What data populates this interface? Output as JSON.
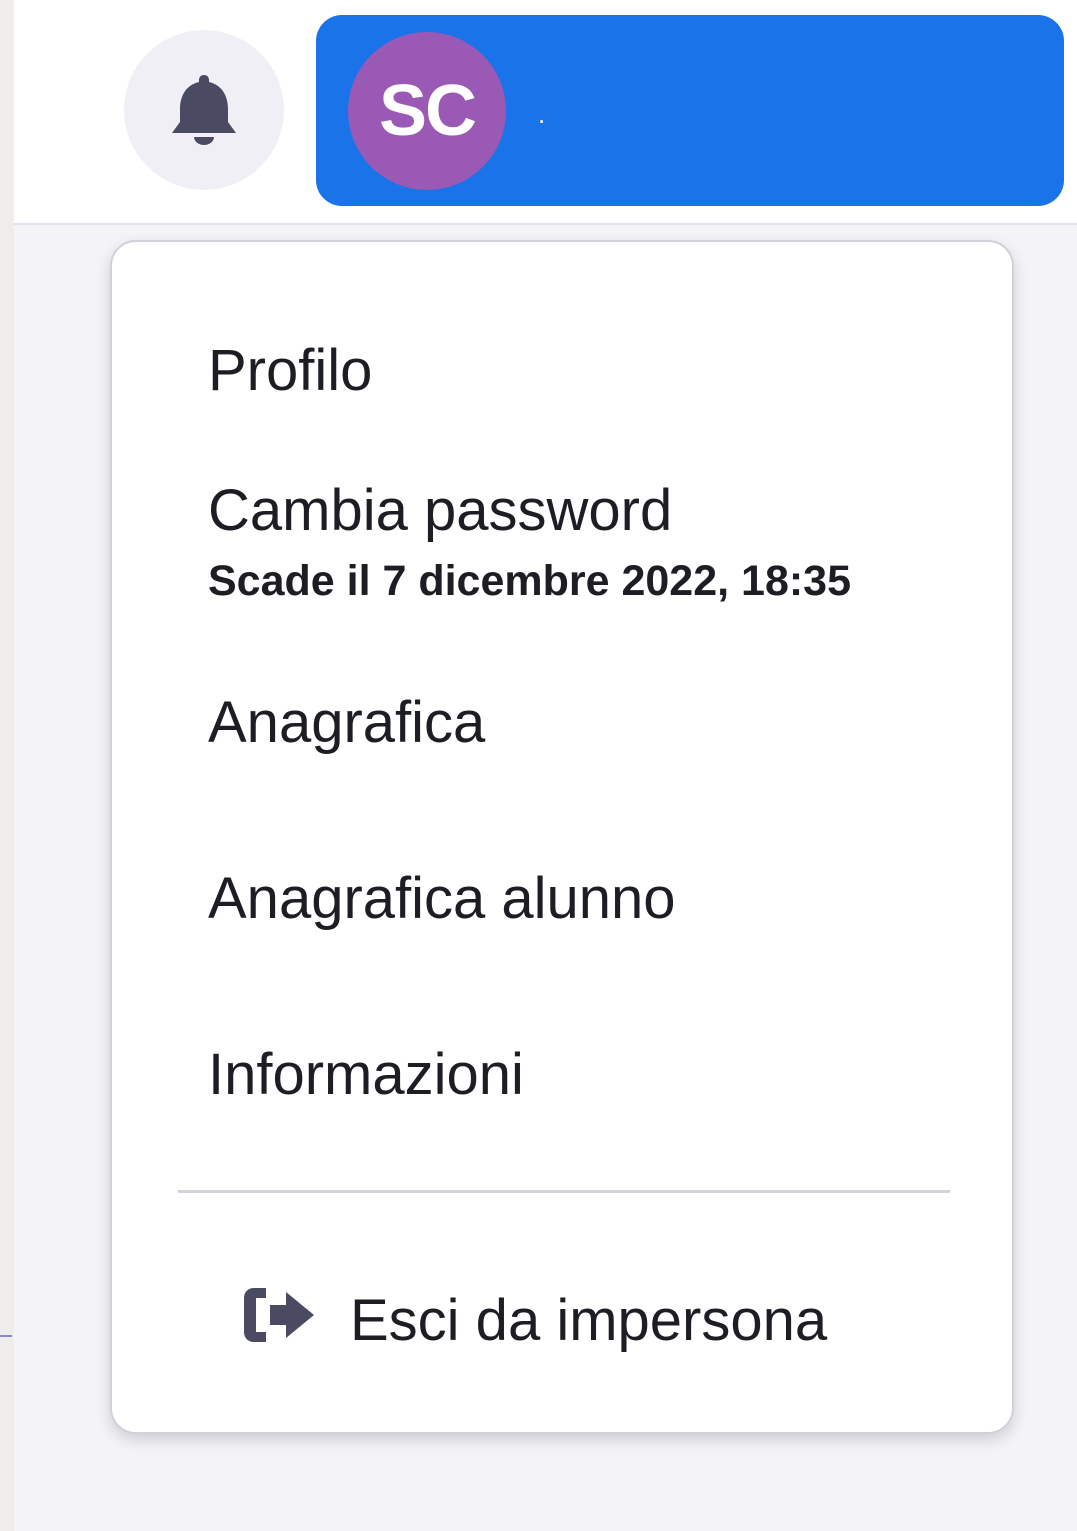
{
  "header": {
    "bell": {
      "icon": "bell-icon",
      "icon_color": "#4b4a63"
    },
    "user": {
      "initials": "SC",
      "name": ".",
      "button_color": "#1a73e8",
      "avatar_color": "#9b59b6"
    }
  },
  "menu": {
    "items": [
      {
        "label": "Profilo"
      },
      {
        "label": "Cambia password",
        "subtext": "Scade il 7 dicembre 2022, 18:35"
      },
      {
        "label": "Anagrafica"
      },
      {
        "label": "Anagrafica alunno"
      },
      {
        "label": "Informazioni"
      }
    ],
    "logout": {
      "label": "Esci da impersona",
      "icon": "sign-out-icon",
      "icon_color": "#4b4a63"
    }
  }
}
